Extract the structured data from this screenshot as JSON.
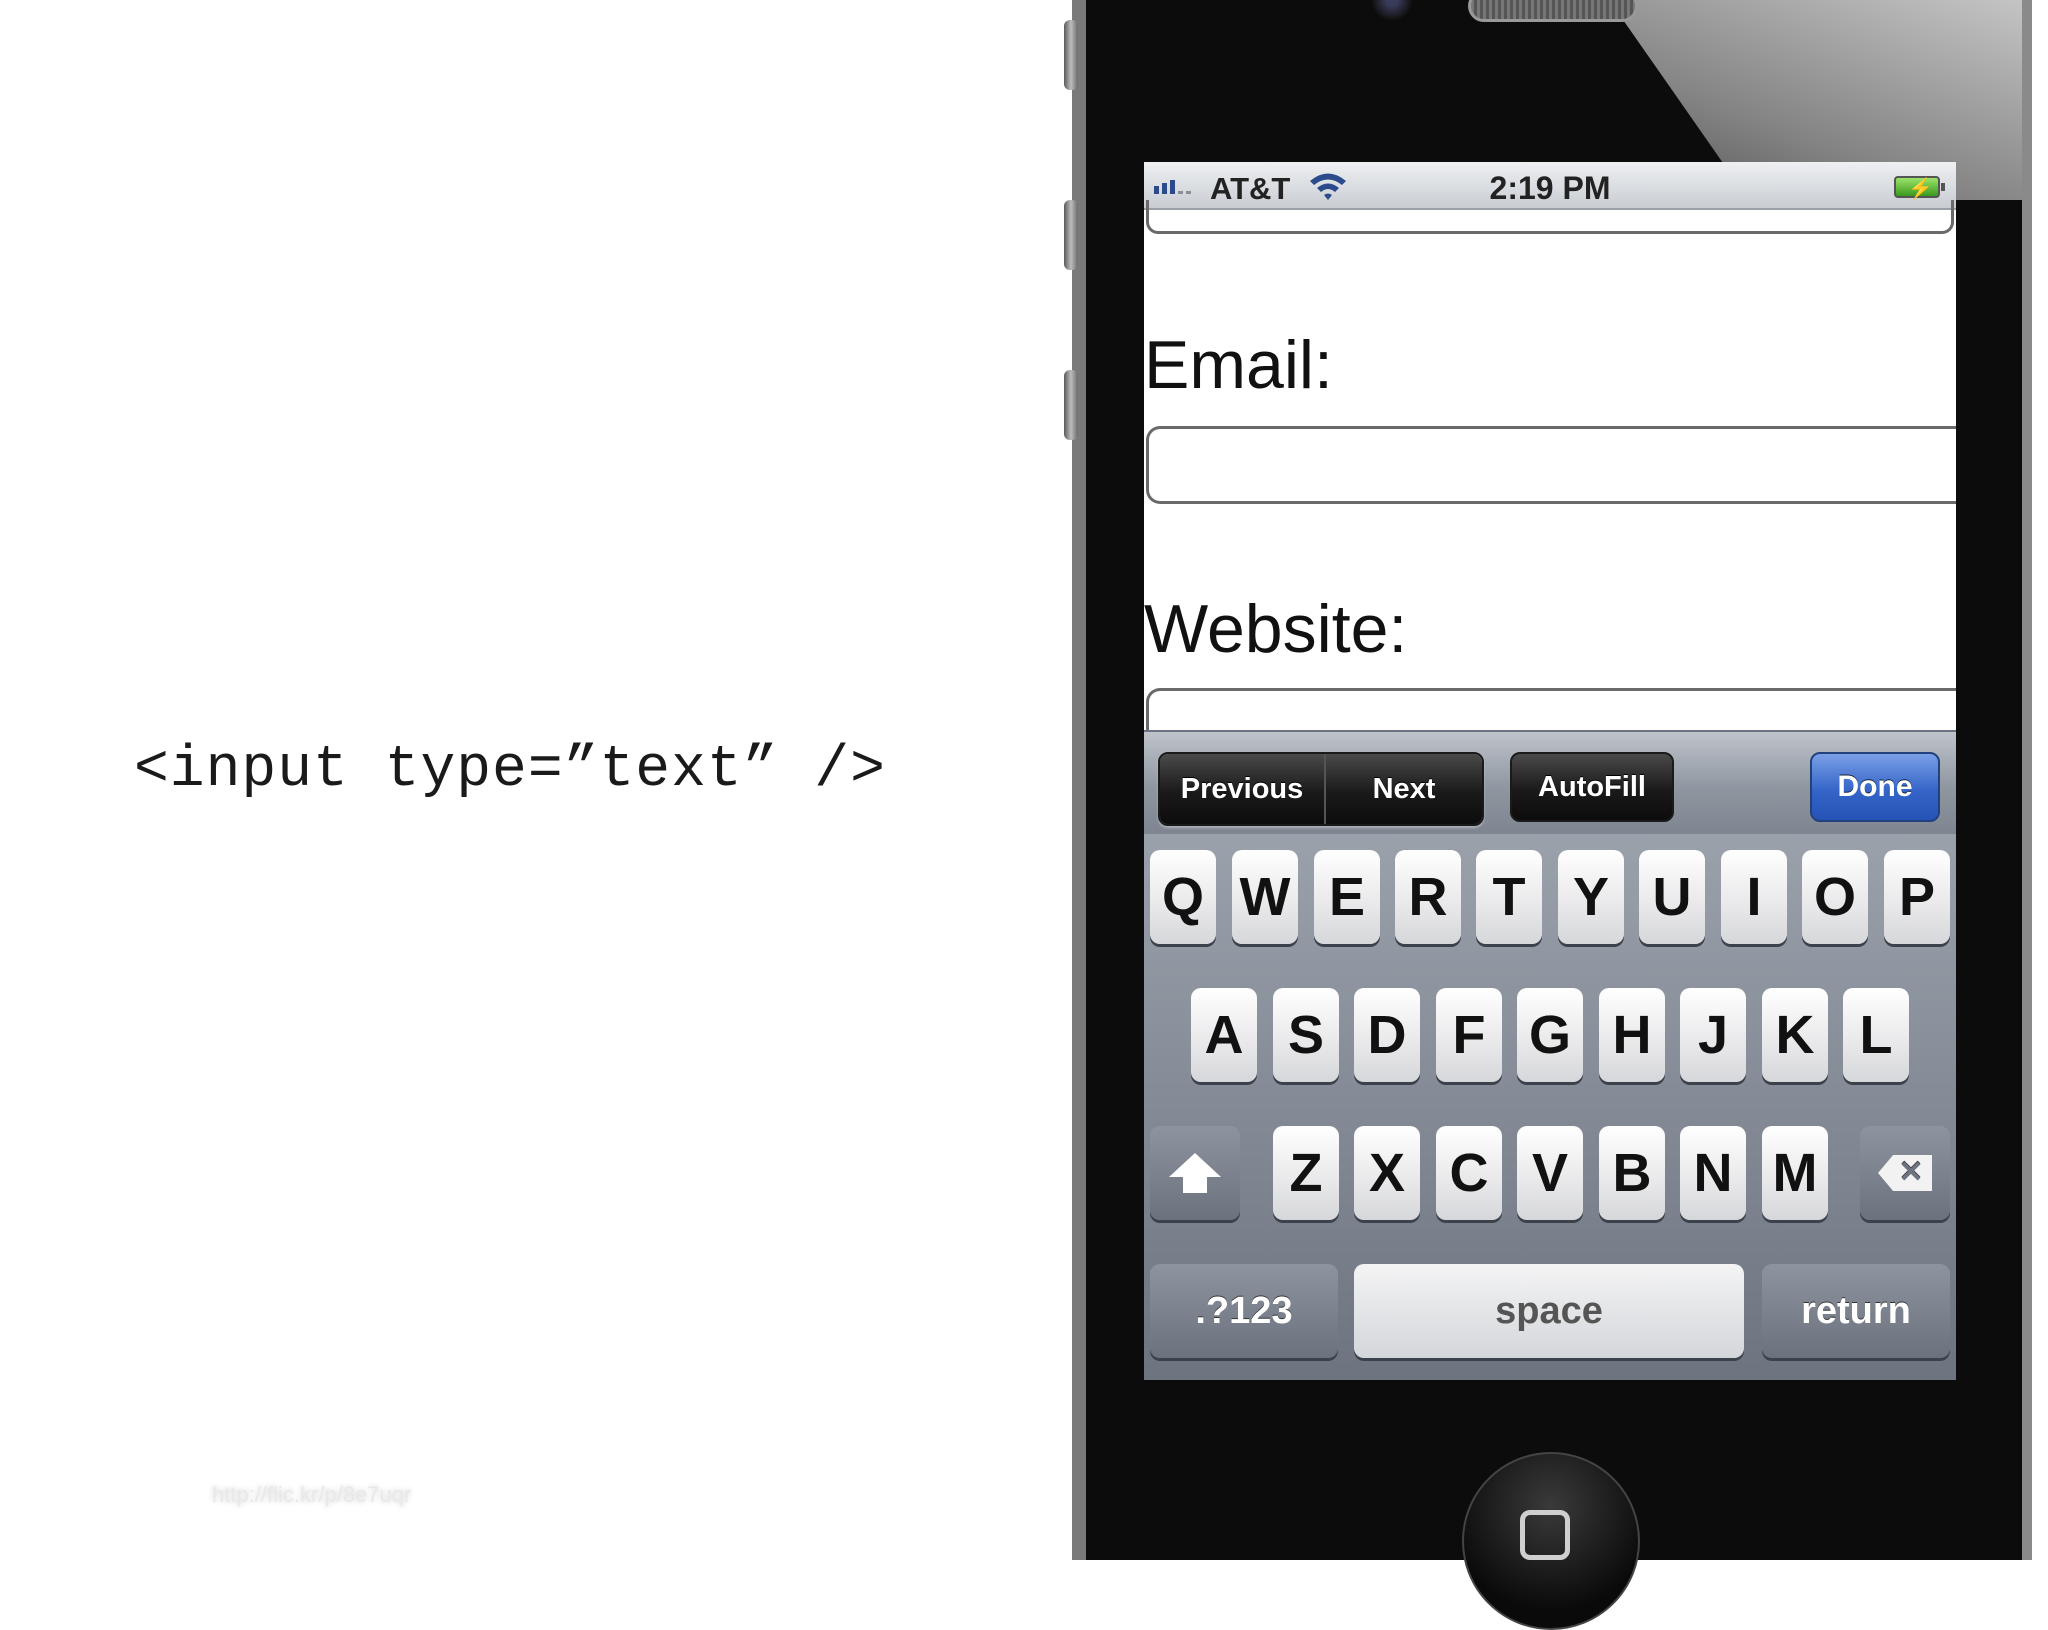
{
  "slide": {
    "code_caption": "<input type=”text” />",
    "source_link": "http://flic.kr/p/8e7uqr"
  },
  "status_bar": {
    "carrier": "AT&T",
    "time": "2:19 PM",
    "signal_bars": 3,
    "battery": "charging"
  },
  "form": {
    "email_label": "Email:",
    "email_value": "",
    "website_label": "Website:",
    "website_value": ""
  },
  "accessory_bar": {
    "previous": "Previous",
    "next": "Next",
    "autofill": "AutoFill",
    "done": "Done"
  },
  "keyboard": {
    "row1": [
      "Q",
      "W",
      "E",
      "R",
      "T",
      "Y",
      "U",
      "I",
      "O",
      "P"
    ],
    "row2": [
      "A",
      "S",
      "D",
      "F",
      "G",
      "H",
      "J",
      "K",
      "L"
    ],
    "row3": [
      "Z",
      "X",
      "C",
      "V",
      "B",
      "N",
      "M"
    ],
    "numbers_key": ".?123",
    "space_key": "space",
    "return_key": "return",
    "shift_icon": "shift-arrow-icon",
    "backspace_icon": "backspace-icon"
  },
  "colors": {
    "done_blue": "#3565c8",
    "keyboard_bg": "#7e8590",
    "signal_blue": "#2b4b8c"
  }
}
